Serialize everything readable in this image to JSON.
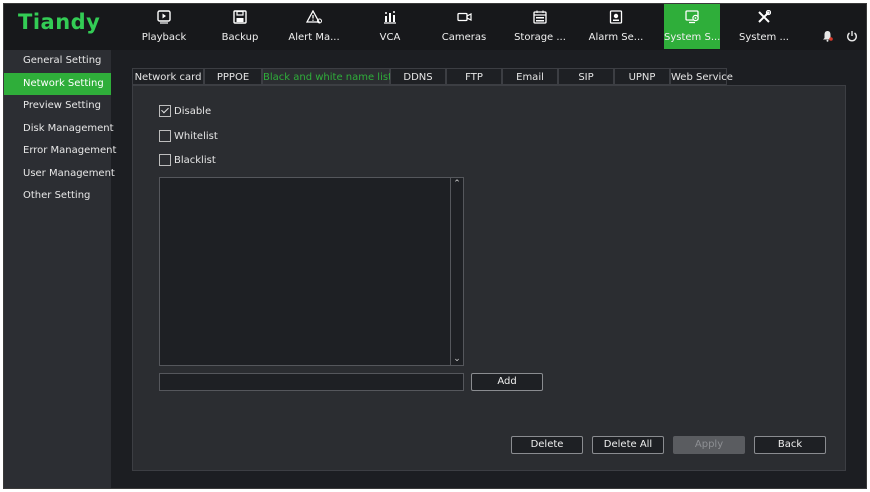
{
  "brand": {
    "logo_text": "Tiandy",
    "logo_color": "#33cc55",
    "accent": "#2fae3a"
  },
  "nav": {
    "items": [
      {
        "label": "Playback",
        "icon": "playback-icon"
      },
      {
        "label": "Backup",
        "icon": "save-icon"
      },
      {
        "label": "Alert Ma...",
        "icon": "alert-icon"
      },
      {
        "label": "VCA",
        "icon": "vca-chart-icon"
      },
      {
        "label": "Cameras",
        "icon": "camera-icon"
      },
      {
        "label": "Storage ...",
        "icon": "storage-icon"
      },
      {
        "label": "Alarm Se...",
        "icon": "alarm-settings-icon"
      },
      {
        "label": "System S...",
        "icon": "system-settings-icon",
        "active": true
      },
      {
        "label": "System ...",
        "icon": "tools-icon"
      }
    ],
    "right_icons": [
      "bell-icon",
      "power-icon"
    ]
  },
  "sidebar": {
    "items": [
      {
        "label": "General Setting"
      },
      {
        "label": "Network Setting",
        "active": true
      },
      {
        "label": "Preview Setting"
      },
      {
        "label": "Disk Management"
      },
      {
        "label": "Error Management"
      },
      {
        "label": "User Management"
      },
      {
        "label": "Other Setting"
      }
    ]
  },
  "tabs": [
    {
      "label": "Network card"
    },
    {
      "label": "PPPOE"
    },
    {
      "label": "Black and white name list",
      "active": true
    },
    {
      "label": "DDNS"
    },
    {
      "label": "FTP"
    },
    {
      "label": "Email"
    },
    {
      "label": "SIP"
    },
    {
      "label": "UPNP"
    },
    {
      "label": "Web Service"
    }
  ],
  "options": {
    "disable": {
      "label": "Disable",
      "checked": true
    },
    "whitelist": {
      "label": "Whitelist",
      "checked": false
    },
    "blacklist": {
      "label": "Blacklist",
      "checked": false
    }
  },
  "entry": {
    "value": "",
    "add_label": "Add"
  },
  "actions": {
    "delete_label": "Delete",
    "delete_all_label": "Delete All",
    "apply_label": "Apply",
    "back_label": "Back"
  }
}
